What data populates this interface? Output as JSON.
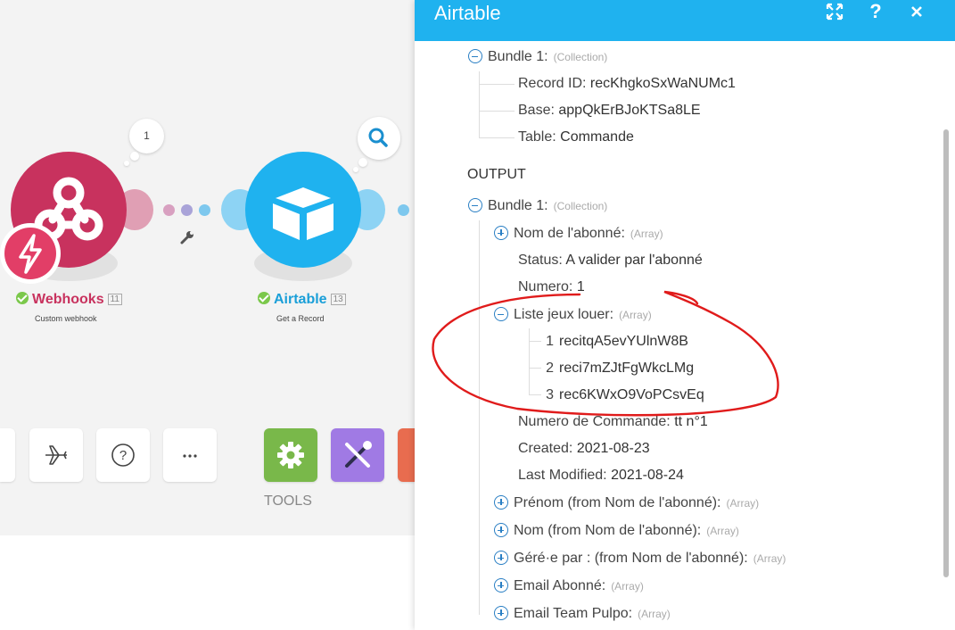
{
  "canvas": {
    "webhooks": {
      "label": "Webhooks",
      "id": "11",
      "sub": "Custom webhook",
      "count": "1"
    },
    "airtable": {
      "label": "Airtable",
      "id": "13",
      "sub": "Get a Record"
    },
    "tools_label": "TOOLS",
    "icons": [
      "plane-icon",
      "help-circle-icon",
      "more-icon",
      "gear-icon",
      "tools-icon"
    ],
    "colors": {
      "webhooks": "#c8325e",
      "airtable": "#1fb2ef",
      "tools_green": "#79b84a",
      "tools_purple": "#a07ae4",
      "tools_red": "#e86c4f"
    }
  },
  "panel": {
    "title": "Airtable",
    "buttons": [
      "expand-icon",
      "help-icon",
      "close-icon"
    ],
    "input": {
      "bundle": "Bundle 1:",
      "bundle_type": "(Collection)",
      "fields": [
        {
          "key": "Record ID:",
          "value": "recKhgkoSxWaNUMc1"
        },
        {
          "key": "Base:",
          "value": "appQkErBJoKTSa8LE"
        },
        {
          "key": "Table:",
          "value": "Commande"
        }
      ]
    },
    "output_label": "OUTPUT",
    "output": {
      "bundle": "Bundle 1:",
      "bundle_type": "(Collection)",
      "nom_abonne": {
        "key": "Nom de l'abonné:",
        "type": "(Array)"
      },
      "status": {
        "key": "Status:",
        "value": "A valider par l'abonné"
      },
      "numero": {
        "key": "Numero:",
        "value": "1"
      },
      "liste": {
        "key": "Liste jeux louer:",
        "type": "(Array)",
        "items": [
          {
            "idx": "1",
            "value": "recitqA5evYUlnW8B"
          },
          {
            "idx": "2",
            "value": "reci7mZJtFgWkcLMg"
          },
          {
            "idx": "3",
            "value": "rec6KWxO9VoPCsvEq"
          }
        ]
      },
      "numero_commande": {
        "key": "Numero de Commande:",
        "value": "tt n°1"
      },
      "created": {
        "key": "Created:",
        "value": "2021-08-23"
      },
      "last_modified": {
        "key": "Last Modified:",
        "value": "2021-08-24"
      },
      "arrays": [
        {
          "key": "Prénom (from Nom de l'abonné):",
          "type": "(Array)"
        },
        {
          "key": "Nom (from Nom de l'abonné):",
          "type": "(Array)"
        },
        {
          "key": "Géré·e par : (from Nom de l'abonné):",
          "type": "(Array)"
        },
        {
          "key": "Email Abonné:",
          "type": "(Array)"
        },
        {
          "key": "Email Team Pulpo:",
          "type": "(Array)"
        }
      ]
    }
  }
}
